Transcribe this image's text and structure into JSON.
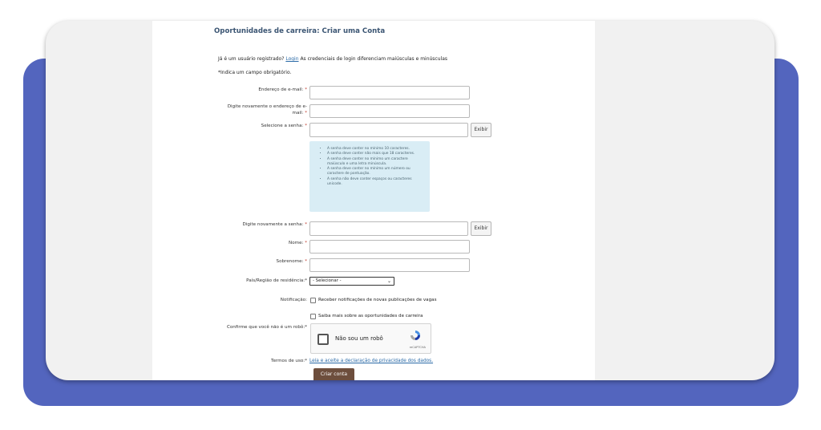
{
  "page_title": "Oportunidades de carreira: Criar uma Conta",
  "registered_prefix": "Já é um usuário registrado?",
  "login_link": "Login",
  "registered_suffix": "As credenciais de login diferenciam maiúsculas e minúsculas",
  "required_note": "*Indica um campo obrigatório.",
  "required_mark": "*",
  "fields": {
    "email_label": "Endereço de e-mail:",
    "email_confirm_label_line1": "Digite novamente o endereço de e-",
    "email_confirm_label_line2": "mail:",
    "password_label": "Selecione a senha:",
    "password_confirm_label": "Digite novamente a senha:",
    "first_name_label": "Nome:",
    "last_name_label": "Sobrenome:",
    "country_label": "País/Região de residência:*",
    "notification_label": "Notificação:",
    "robot_label": "Confirme que você não é um robô:*",
    "terms_label": "Termos de uso:*"
  },
  "show_button": "Exibir",
  "password_rules": [
    "A senha deve conter no mínimo 10 caracteres.",
    "A senha deve conter não mais que 18 caracteres.",
    "A senha deve conter no mínimo um caractere maiúsculo e uma letra minúscula.",
    "A senha deve conter no mínimo um número ou caractere de pontuação.",
    "A senha não deve conter espaços ou caracteres unicode."
  ],
  "country_select": {
    "value": "- Selecionar -"
  },
  "notification_option": "Receber notificações de novas publicações de vagas",
  "careers_option": "Saiba mais sobre as oportunidades de carreira",
  "captcha": {
    "text": "Não sou um robô",
    "brand": "reCAPTCHA"
  },
  "terms_link": "Leia e aceite a declaração de privacidade dos dados.",
  "submit_button": "Criar conta",
  "colors": {
    "accent_blue": "#5365be",
    "submit_brown": "#6d4e3d",
    "hint_bg": "#d9edf5"
  }
}
